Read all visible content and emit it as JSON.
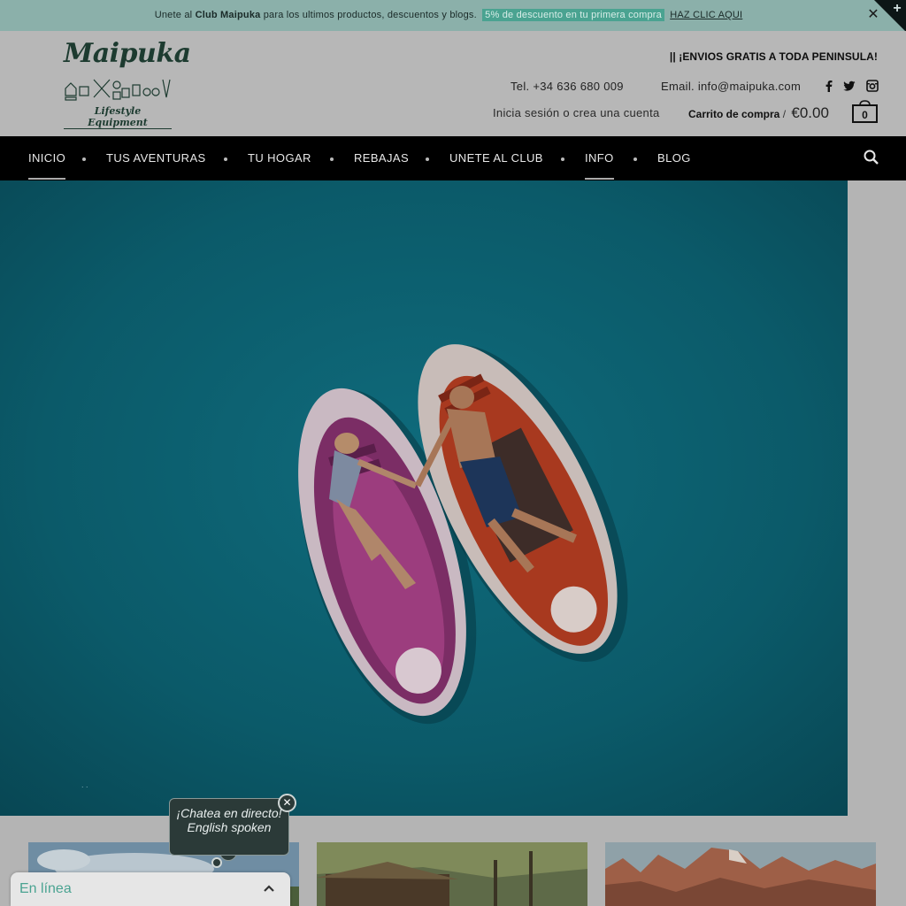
{
  "announcement": {
    "prefix": "Unete al",
    "club": "Club Maipuka",
    "middle": "para los ultimos productos, descuentos y blogs.",
    "discount": "5% de descuento en tu primera compra",
    "cta": "HAZ CLIC AQUI",
    "close_icon": "close-icon",
    "bg_color": "#8bb0aa",
    "accent_color": "#4aa391"
  },
  "header": {
    "logo": {
      "wordmark": "Maipuka",
      "tagline": "Lifestyle Equipment"
    },
    "shipping": "|| ¡ENVIOS GRATIS A TODA PENINSULA!",
    "phone": "Tel. +34 636 680 009",
    "email": "Email. info@maipuka.com",
    "social": [
      "facebook-icon",
      "twitter-icon",
      "instagram-icon"
    ],
    "login": "Inicia sesión o crea una cuenta",
    "cart": {
      "label": "Carrito de compra",
      "separator": "/",
      "amount": "€0.00",
      "count": "0"
    }
  },
  "nav": {
    "items": [
      {
        "label": "INICIO",
        "active": true
      },
      {
        "label": "TUS AVENTURAS",
        "active": false
      },
      {
        "label": "TU HOGAR",
        "active": false
      },
      {
        "label": "REBAJAS",
        "active": false
      },
      {
        "label": "UNETE AL CLUB",
        "active": false
      },
      {
        "label": "INFO",
        "active": true
      },
      {
        "label": "BLOG",
        "active": false
      }
    ],
    "search_icon": "search-icon"
  },
  "chat": {
    "bubble": "¡Chatea en directo! English spoken",
    "status": "En línea",
    "chevron_icon": "chevron-up-icon"
  }
}
